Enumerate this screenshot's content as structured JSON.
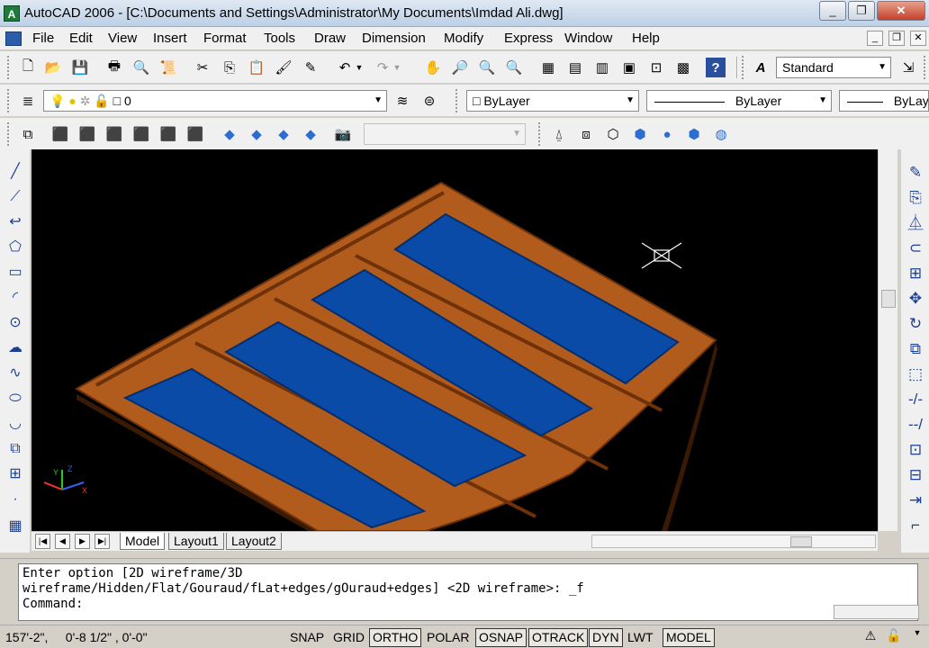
{
  "title": {
    "text": "AutoCAD 2006 - [C:\\Documents and Settings\\Administrator\\My Documents\\Imdad Ali.dwg]",
    "app_glyph": "A"
  },
  "window_controls": {
    "minimize": "_",
    "restore": "❐",
    "close": "✕"
  },
  "mdi_controls": {
    "minimize": "_",
    "restore": "❐",
    "close": "✕"
  },
  "menu": [
    "File",
    "Edit",
    "View",
    "Insert",
    "Format",
    "Tools",
    "Draw",
    "Dimension",
    "Modify",
    "Express",
    "Window",
    "Help"
  ],
  "toolbar_standard": {
    "text_style": "Standard"
  },
  "toolbar_layers": {
    "current_layer": "0",
    "color": "ByLayer",
    "linetype": "ByLayer",
    "lineweight": "ByLayer"
  },
  "toolbar_view": {
    "named_view": ""
  },
  "tabs": {
    "model": "Model",
    "layout1": "Layout1",
    "layout2": "Layout2"
  },
  "nav": {
    "first": "|◀",
    "prev": "◀",
    "next": "▶",
    "last": "▶|"
  },
  "command": {
    "line1": "Enter option [2D wireframe/3D",
    "line2": "wireframe/Hidden/Flat/Gouraud/fLat+edges/gOuraud+edges] <2D wireframe>: _f",
    "line3": "Command:"
  },
  "status": {
    "coordinates": "157'-2\",     0'-8 1/2\" , 0'-0\"",
    "snap": "SNAP",
    "grid": "GRID",
    "ortho": "ORTHO",
    "polar": "POLAR",
    "osnap": "OSNAP",
    "otrack": "OTRACK",
    "dyn": "DYN",
    "lwt": "LWT",
    "model": "MODEL"
  },
  "ucs": {
    "x": "X",
    "y": "Y",
    "z": "Z"
  },
  "colors": {
    "frame": "#b15c1c",
    "frame_dark": "#6e3108",
    "glass": "#0a4ba8",
    "viewport_bg": "#000000"
  }
}
